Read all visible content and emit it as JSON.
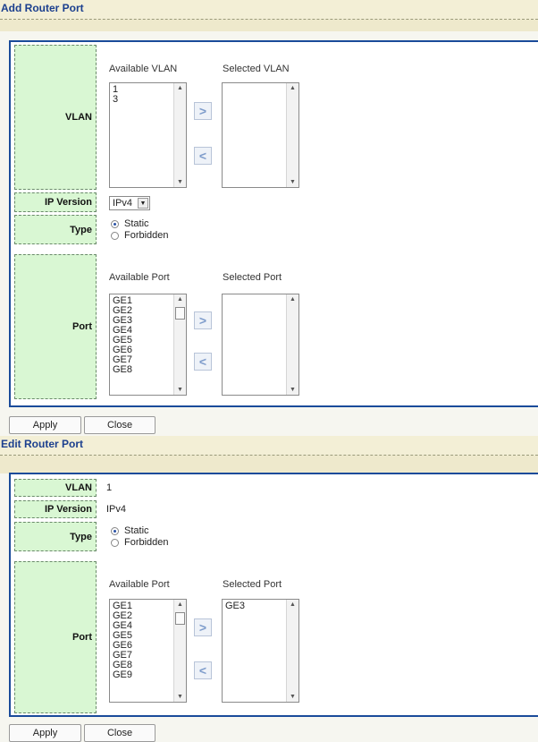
{
  "add": {
    "title": "Add Router Port",
    "labels": {
      "vlan": "VLAN",
      "ip_version": "IP Version",
      "type": "Type",
      "port": "Port"
    },
    "vlan": {
      "available_caption": "Available VLAN",
      "selected_caption": "Selected VLAN",
      "available": [
        "1",
        "3"
      ],
      "selected": []
    },
    "ip_version": {
      "value": "IPv4"
    },
    "type": {
      "options": [
        "Static",
        "Forbidden"
      ],
      "selected": "Static"
    },
    "port": {
      "available_caption": "Available Port",
      "selected_caption": "Selected Port",
      "available": [
        "GE1",
        "GE2",
        "GE3",
        "GE4",
        "GE5",
        "GE6",
        "GE7",
        "GE8"
      ],
      "selected": []
    },
    "buttons": {
      "apply": "Apply",
      "close": "Close"
    }
  },
  "edit": {
    "title": "Edit Router Port",
    "labels": {
      "vlan": "VLAN",
      "ip_version": "IP Version",
      "type": "Type",
      "port": "Port"
    },
    "vlan_value": "1",
    "ip_version_value": "IPv4",
    "type": {
      "options": [
        "Static",
        "Forbidden"
      ],
      "selected": "Static"
    },
    "port": {
      "available_caption": "Available Port",
      "selected_caption": "Selected Port",
      "available": [
        "GE1",
        "GE2",
        "GE4",
        "GE5",
        "GE6",
        "GE7",
        "GE8",
        "GE9"
      ],
      "selected": [
        "GE3"
      ]
    },
    "buttons": {
      "apply": "Apply",
      "close": "Close"
    }
  },
  "icons": {
    "move_right": "chevron-right-icon",
    "move_left": "chevron-left-icon"
  }
}
